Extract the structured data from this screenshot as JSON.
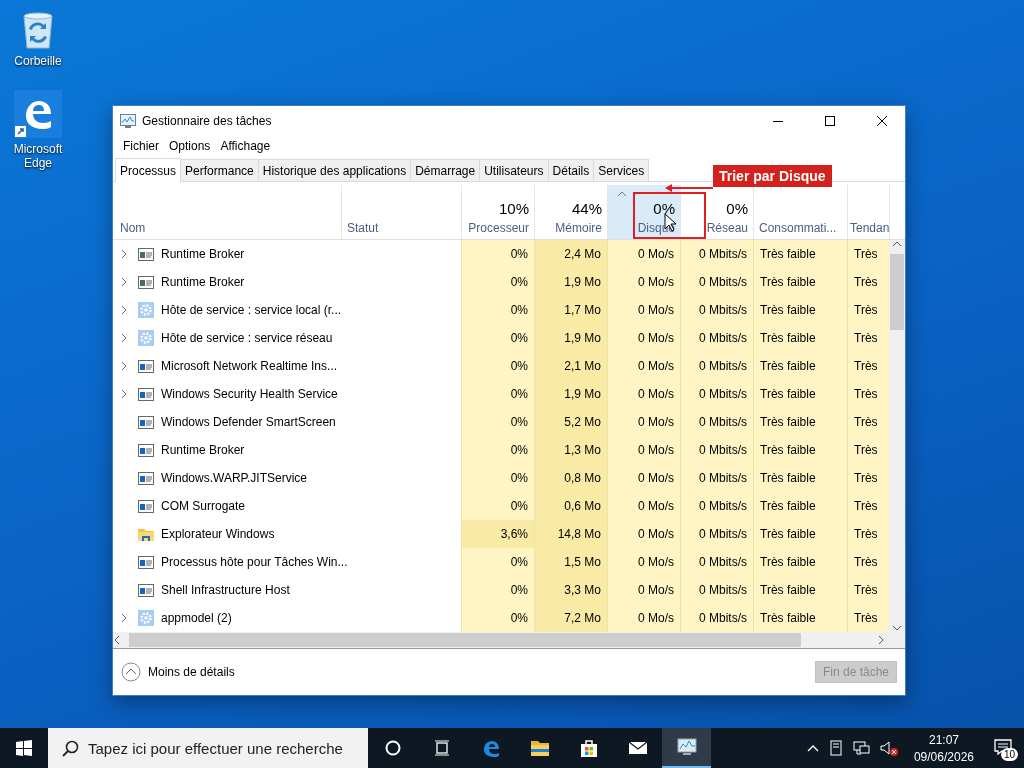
{
  "desktop_icons": [
    {
      "label": "Corbeille",
      "kind": "recycle"
    },
    {
      "label": "Microsoft Edge",
      "kind": "edge"
    }
  ],
  "window": {
    "title": "Gestionnaire des tâches"
  },
  "menu": [
    "Fichier",
    "Options",
    "Affichage"
  ],
  "tabs": [
    {
      "label": "Processus",
      "selected": true
    },
    {
      "label": "Performance",
      "selected": false
    },
    {
      "label": "Historique des applications",
      "selected": false
    },
    {
      "label": "Démarrage",
      "selected": false
    },
    {
      "label": "Utilisateurs",
      "selected": false
    },
    {
      "label": "Détails",
      "selected": false
    },
    {
      "label": "Services",
      "selected": false
    }
  ],
  "table": {
    "columns": [
      {
        "label": "Nom",
        "kind": "name",
        "sorted": false,
        "highlighted": false
      },
      {
        "label": "Statut",
        "kind": "status",
        "sorted": false,
        "highlighted": false
      },
      {
        "label": "Processeur",
        "total": "10%",
        "kind": "number",
        "sorted": false,
        "highlighted": false
      },
      {
        "label": "Mémoire",
        "total": "44%",
        "kind": "number-heavy",
        "sorted": false,
        "highlighted": false
      },
      {
        "label": "Disque",
        "total": "0%",
        "kind": "number",
        "sorted": true,
        "highlighted": true,
        "callout": "Trier par Disque"
      },
      {
        "label": "Réseau",
        "total": "0%",
        "kind": "number",
        "sorted": false,
        "highlighted": false
      },
      {
        "label": "Consommati...",
        "kind": "rating",
        "sorted": false,
        "highlighted": false
      },
      {
        "label": "Tendan",
        "kind": "rating",
        "sorted": false,
        "highlighted": false
      }
    ],
    "rows": [
      {
        "kind": "app-grey",
        "expandable": true,
        "cpu_active": false,
        "cells": [
          "Runtime Broker",
          "",
          "0%",
          "2,4 Mo",
          "0 Mo/s",
          "0 Mbits/s",
          "Très faible",
          "Très"
        ]
      },
      {
        "kind": "app-grey",
        "expandable": true,
        "cpu_active": false,
        "cells": [
          "Runtime Broker",
          "",
          "0%",
          "1,9 Mo",
          "0 Mo/s",
          "0 Mbits/s",
          "Très faible",
          "Très"
        ]
      },
      {
        "kind": "service",
        "expandable": true,
        "cpu_active": false,
        "cells": [
          "Hôte de service : service local (r...",
          "",
          "0%",
          "1,7 Mo",
          "0 Mo/s",
          "0 Mbits/s",
          "Très faible",
          "Très"
        ]
      },
      {
        "kind": "service",
        "expandable": true,
        "cpu_active": false,
        "cells": [
          "Hôte de service : service réseau",
          "",
          "0%",
          "1,9 Mo",
          "0 Mo/s",
          "0 Mbits/s",
          "Très faible",
          "Très"
        ]
      },
      {
        "kind": "app",
        "expandable": true,
        "cpu_active": false,
        "cells": [
          "Microsoft Network Realtime Ins...",
          "",
          "0%",
          "2,1 Mo",
          "0 Mo/s",
          "0 Mbits/s",
          "Très faible",
          "Très"
        ]
      },
      {
        "kind": "app",
        "expandable": true,
        "cpu_active": false,
        "cells": [
          "Windows Security Health Service",
          "",
          "0%",
          "1,9 Mo",
          "0 Mo/s",
          "0 Mbits/s",
          "Très faible",
          "Très"
        ]
      },
      {
        "kind": "app",
        "expandable": false,
        "cpu_active": false,
        "cells": [
          "Windows Defender SmartScreen",
          "",
          "0%",
          "5,2 Mo",
          "0 Mo/s",
          "0 Mbits/s",
          "Très faible",
          "Très"
        ]
      },
      {
        "kind": "app",
        "expandable": false,
        "cpu_active": false,
        "cells": [
          "Runtime Broker",
          "",
          "0%",
          "1,3 Mo",
          "0 Mo/s",
          "0 Mbits/s",
          "Très faible",
          "Très"
        ]
      },
      {
        "kind": "app",
        "expandable": false,
        "cpu_active": false,
        "cells": [
          "Windows.WARP.JITService",
          "",
          "0%",
          "0,8 Mo",
          "0 Mo/s",
          "0 Mbits/s",
          "Très faible",
          "Très"
        ]
      },
      {
        "kind": "app",
        "expandable": false,
        "cpu_active": false,
        "cells": [
          "COM Surrogate",
          "",
          "0%",
          "0,6 Mo",
          "0 Mo/s",
          "0 Mbits/s",
          "Très faible",
          "Très"
        ]
      },
      {
        "kind": "folder",
        "expandable": false,
        "cpu_active": true,
        "cells": [
          "Explorateur Windows",
          "",
          "3,6%",
          "14,8 Mo",
          "0 Mo/s",
          "0 Mbits/s",
          "Très faible",
          "Très"
        ]
      },
      {
        "kind": "app",
        "expandable": false,
        "cpu_active": false,
        "cells": [
          "Processus hôte pour Tâches Win...",
          "",
          "0%",
          "1,5 Mo",
          "0 Mo/s",
          "0 Mbits/s",
          "Très faible",
          "Très"
        ]
      },
      {
        "kind": "app",
        "expandable": false,
        "cpu_active": false,
        "cells": [
          "Shell Infrastructure Host",
          "",
          "0%",
          "3,3 Mo",
          "0 Mo/s",
          "0 Mbits/s",
          "Très faible",
          "Très"
        ]
      },
      {
        "kind": "service",
        "expandable": true,
        "cpu_active": false,
        "cells": [
          "appmodel (2)",
          "",
          "0%",
          "7,2 Mo",
          "0 Mo/s",
          "0 Mbits/s",
          "Très faible",
          "Très"
        ]
      }
    ]
  },
  "footer": {
    "details_toggle": "Moins de détails",
    "end_task": {
      "label": "Fin de tâche",
      "disabled": true
    }
  },
  "taskbar": {
    "search": {
      "placeholder": "Tapez ici pour effectuer une recherche"
    },
    "apps": [
      {
        "kind": "cortana",
        "active": false
      },
      {
        "kind": "taskview",
        "active": false
      },
      {
        "kind": "edge",
        "active": false
      },
      {
        "kind": "explorer",
        "active": false
      },
      {
        "kind": "store",
        "active": false
      },
      {
        "kind": "mail",
        "active": false
      },
      {
        "kind": "taskmgr",
        "active": true
      }
    ],
    "time": "21:07",
    "date": "09/06/2026",
    "notifications": "10"
  }
}
